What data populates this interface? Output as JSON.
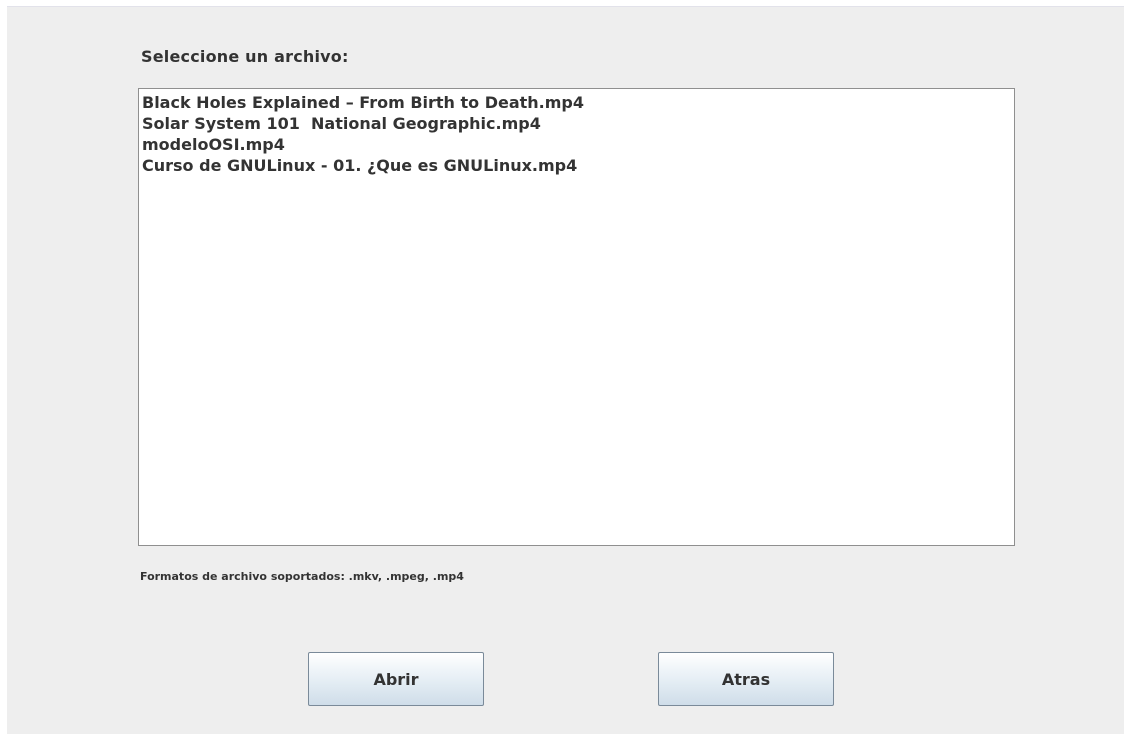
{
  "dialog": {
    "prompt_label": "Seleccione un archivo:",
    "files": [
      "Black Holes Explained – From Birth to Death.mp4",
      "Solar System 101  National Geographic.mp4",
      "modeloOSI.mp4",
      "Curso de GNULinux - 01. ¿Que es GNULinux.mp4"
    ],
    "formats_note": "Formatos de archivo soportados: .mkv, .mpeg, .mp4",
    "buttons": {
      "open_label": "Abrir",
      "back_label": "Atras"
    }
  },
  "colors": {
    "panel_background": "#eeeeee",
    "list_background": "#ffffff",
    "text": "#333333",
    "button_border": "#7a8a99"
  }
}
